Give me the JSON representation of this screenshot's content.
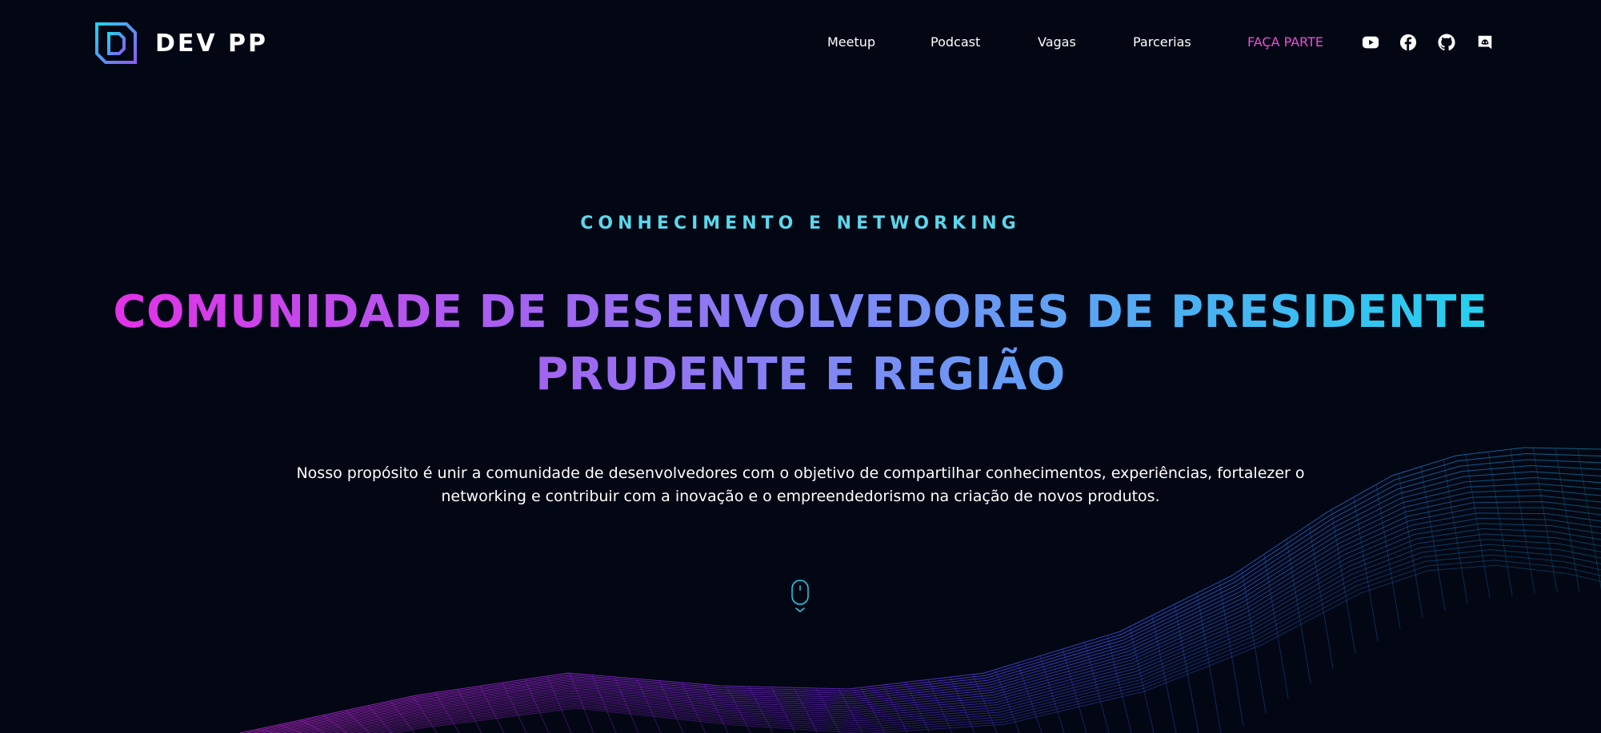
{
  "brand": {
    "name": "DEV PP",
    "logo_letter": "D",
    "logo_icon": "dev-pp-logo-icon"
  },
  "nav": {
    "items": [
      {
        "label": "Meetup"
      },
      {
        "label": "Podcast"
      },
      {
        "label": "Vagas"
      },
      {
        "label": "Parcerias"
      },
      {
        "label": "FAÇA PARTE"
      }
    ],
    "social": [
      {
        "icon": "youtube-icon"
      },
      {
        "icon": "facebook-icon"
      },
      {
        "icon": "github-icon"
      },
      {
        "icon": "discord-icon"
      }
    ]
  },
  "hero": {
    "eyebrow": "CONHECIMENTO E NETWORKING",
    "headline": "COMUNIDADE DE DESENVOLVEDORES DE PRESIDENTE PRUDENTE E REGIÃO",
    "description": "Nosso propósito é unir a comunidade de desenvolvedores com o objetivo de compartilhar conhecimentos, experiências, fortalezer o networking e contribuir com a inovação e o empreendedorismo na criação de novos produtos.",
    "scroll_icon": "mouse-scroll-icon"
  },
  "colors": {
    "background": "#030714",
    "accent_cyan": "#22d3ee",
    "accent_magenta": "#e530e6",
    "nav_highlight": "#ec4fd6",
    "eyebrow": "#5ad7ec"
  }
}
